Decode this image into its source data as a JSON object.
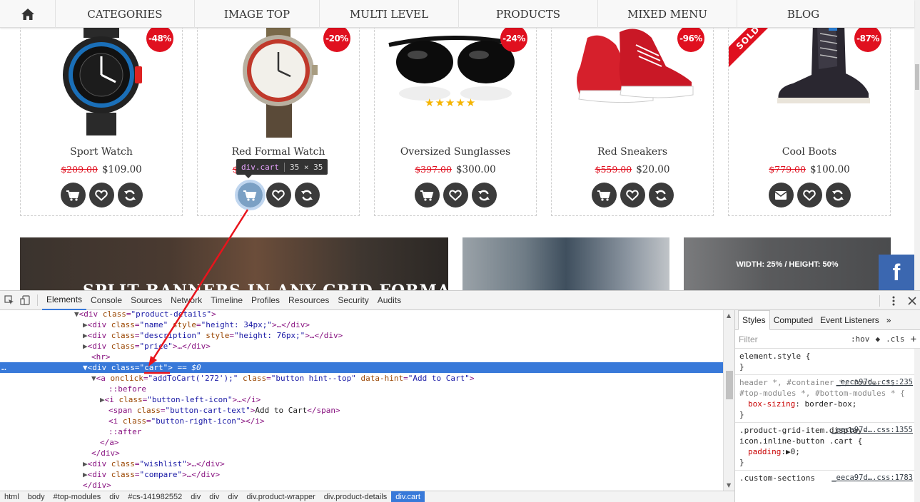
{
  "nav": {
    "home_icon": "home-icon",
    "items": [
      "CATEGORIES",
      "IMAGE TOP",
      "MULTI LEVEL",
      "PRODUCTS",
      "MIXED MENU",
      "BLOG"
    ]
  },
  "products": [
    {
      "name": "Sport Watch",
      "old_price": "$209.00",
      "price": "$109.00",
      "discount": "-48%"
    },
    {
      "name": "Red Formal Watch",
      "old_price": "$",
      "price": "0",
      "discount": "-20%"
    },
    {
      "name": "Oversized Sunglasses",
      "old_price": "$397.00",
      "price": "$300.00",
      "discount": "-24%",
      "rating": 5
    },
    {
      "name": "Red Sneakers",
      "old_price": "$559.00",
      "price": "$20.00",
      "discount": "-96%"
    },
    {
      "name": "Cool Boots",
      "old_price": "$779.00",
      "price": "$100.00",
      "discount": "-87%",
      "ribbon": "SOLD"
    }
  ],
  "tooltip": {
    "tag": "div.cart",
    "dims": "35 × 35"
  },
  "banners": {
    "left_title": "SPLIT BANNERS IN ANY GRID FORMAT",
    "right_text": "WIDTH: 25%  /  HEIGHT: 50%"
  },
  "facebook": {
    "label": "f"
  },
  "devtools": {
    "tabs": [
      "Elements",
      "Console",
      "Sources",
      "Network",
      "Timeline",
      "Profiles",
      "Resources",
      "Security",
      "Audits"
    ],
    "active_tab": "Elements",
    "dom_lines": {
      "l0": {
        "tag_open": "<div ",
        "attr": "class",
        "val": "\"product-details\"",
        "close": ">"
      },
      "l1": {
        "attr1": "class",
        "val1": "\"name\"",
        "attr2": "style",
        "val2": "\"height: 34px;\"",
        "tail": ">…</div>"
      },
      "l2": {
        "attr1": "class",
        "val1": "\"description\"",
        "attr2": "style",
        "val2": "\"height: 76px;\"",
        "tail": ">…</div>"
      },
      "l3": {
        "attr": "class",
        "val": "\"price\"",
        "tail": ">…</div>"
      },
      "l4": {
        "text": "<hr>"
      },
      "l5": {
        "attr": "class",
        "val": "\"cart\"",
        "tail": " == $0"
      },
      "l6": {
        "onclick": "\"addToCart('272');\"",
        "class_val": "\"button hint--top\"",
        "hint_val": "\"Add to Cart\""
      },
      "l7": {
        "text": "::before"
      },
      "l8": {
        "attr": "class",
        "val": "\"button-left-icon\"",
        "tail": ">…</i>"
      },
      "l9": {
        "attr": "class",
        "val": "\"button-cart-text\"",
        "text": "Add to Cart"
      },
      "l10": {
        "attr": "class",
        "val": "\"button-right-icon\"",
        "tail": "></i>"
      },
      "l11": {
        "text": "::after"
      },
      "l12": {
        "text": "</a>"
      },
      "l13": {
        "text": "</div>"
      },
      "l14": {
        "attr": "class",
        "val": "\"wishlist\"",
        "tail": ">…</div>"
      },
      "l15": {
        "attr": "class",
        "val": "\"compare\"",
        "tail": ">…</div>"
      },
      "l16": {
        "text": "</div>"
      }
    },
    "breadcrumbs": [
      "html",
      "body",
      "#top-modules",
      "div",
      "#cs-141982552",
      "div",
      "div",
      "div",
      "div.product-wrapper",
      "div.product-details",
      "div.cart"
    ],
    "styles_tabs": [
      "Styles",
      "Computed",
      "Event Listeners"
    ],
    "filter_placeholder": "Filter",
    "filter_hov": ":hov",
    "filter_cls": ".cls",
    "rules": {
      "r0": {
        "selector": "element.style {",
        "close": "}"
      },
      "r1": {
        "source": "_eeca97d….css:235",
        "selector": "header *, #container *, footer *, #top-modules *, #bottom-modules * {",
        "prop": "box-sizing",
        "value": "border-box;",
        "close": "}"
      },
      "r2": {
        "source": "_eeca97d….css:1355",
        "selector": ".product-grid-item.display-icon.inline-button .cart {",
        "prop": "padding",
        "value": "0;",
        "close": "}"
      },
      "r3": {
        "source": "_eeca97d….css:1783",
        "selector": ".custom-sections"
      }
    }
  }
}
